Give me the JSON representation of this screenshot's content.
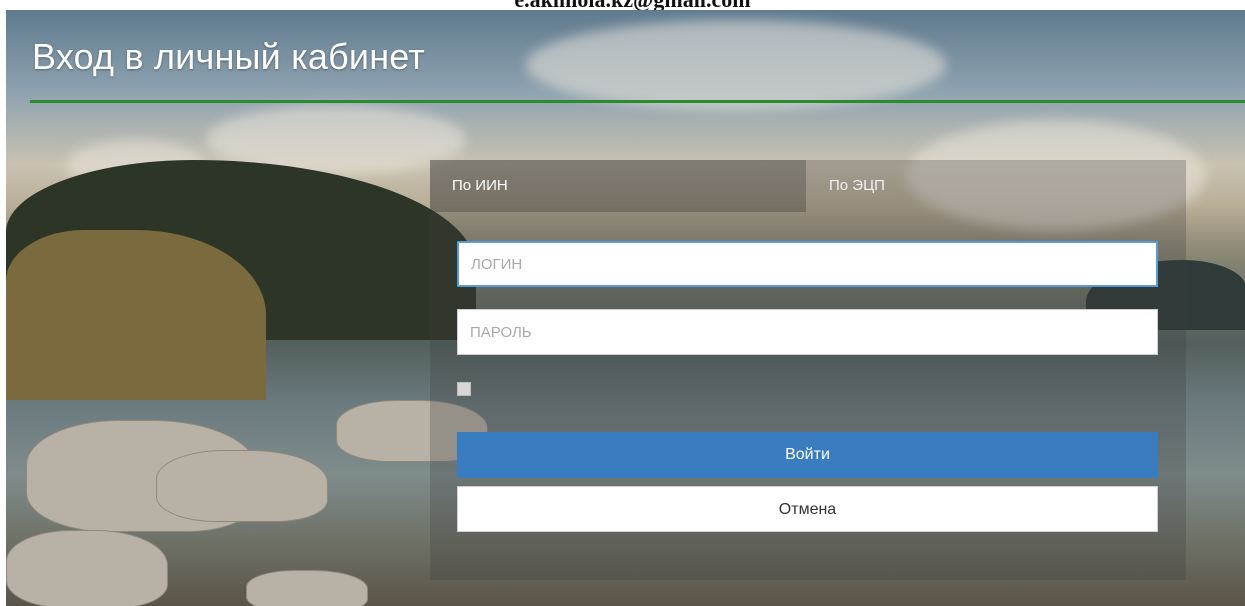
{
  "header": {
    "email": "e.akimola.kz@gmail.com",
    "title": "Вход в личный кабинет"
  },
  "tabs": [
    {
      "label": "По ИИН",
      "active": true
    },
    {
      "label": "По ЭЦП",
      "active": false
    }
  ],
  "form": {
    "login_placeholder": "ЛОГИН",
    "password_placeholder": "ПАРОЛЬ",
    "login_button": "Войти",
    "cancel_button": "Отмена"
  },
  "colors": {
    "accent_line": "#2f8a2f",
    "primary_button": "#3a7cc0",
    "input_focus": "#5b9bd5"
  }
}
